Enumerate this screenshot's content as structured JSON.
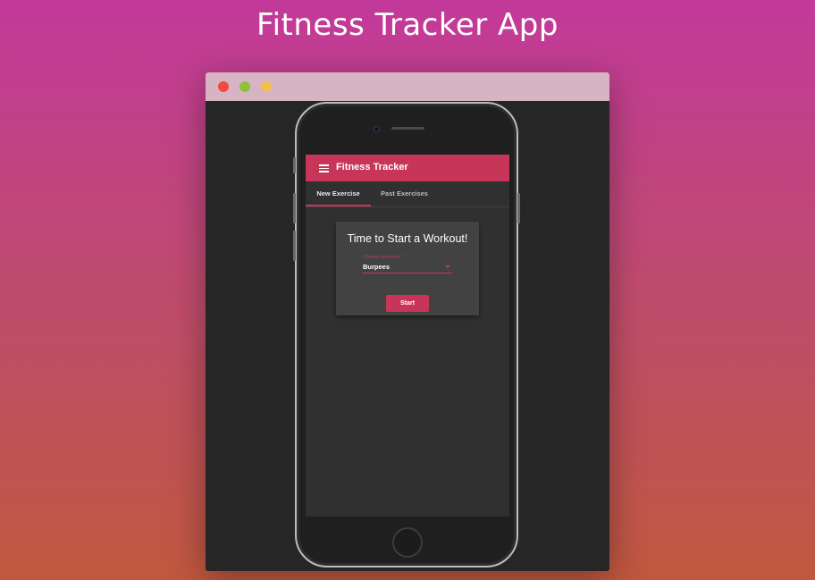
{
  "page": {
    "title": "Fitness Tracker App"
  },
  "window": {
    "controls": {
      "close_color": "#f34a40",
      "minimize_color": "#8fc13d",
      "maximize_color": "#f5be4f"
    }
  },
  "app": {
    "toolbar": {
      "title": "Fitness Tracker",
      "menu_icon": "hamburger-menu-icon"
    },
    "tabs": [
      {
        "label": "New Exercise",
        "active": true
      },
      {
        "label": "Past Exercises",
        "active": false
      }
    ],
    "card": {
      "title": "Time to Start a Workout!",
      "select": {
        "label": "Choose Exercise *",
        "value": "Burpees"
      },
      "start_label": "Start"
    }
  },
  "colors": {
    "accent": "#c73659",
    "surface": "#424242",
    "background": "#303030"
  }
}
